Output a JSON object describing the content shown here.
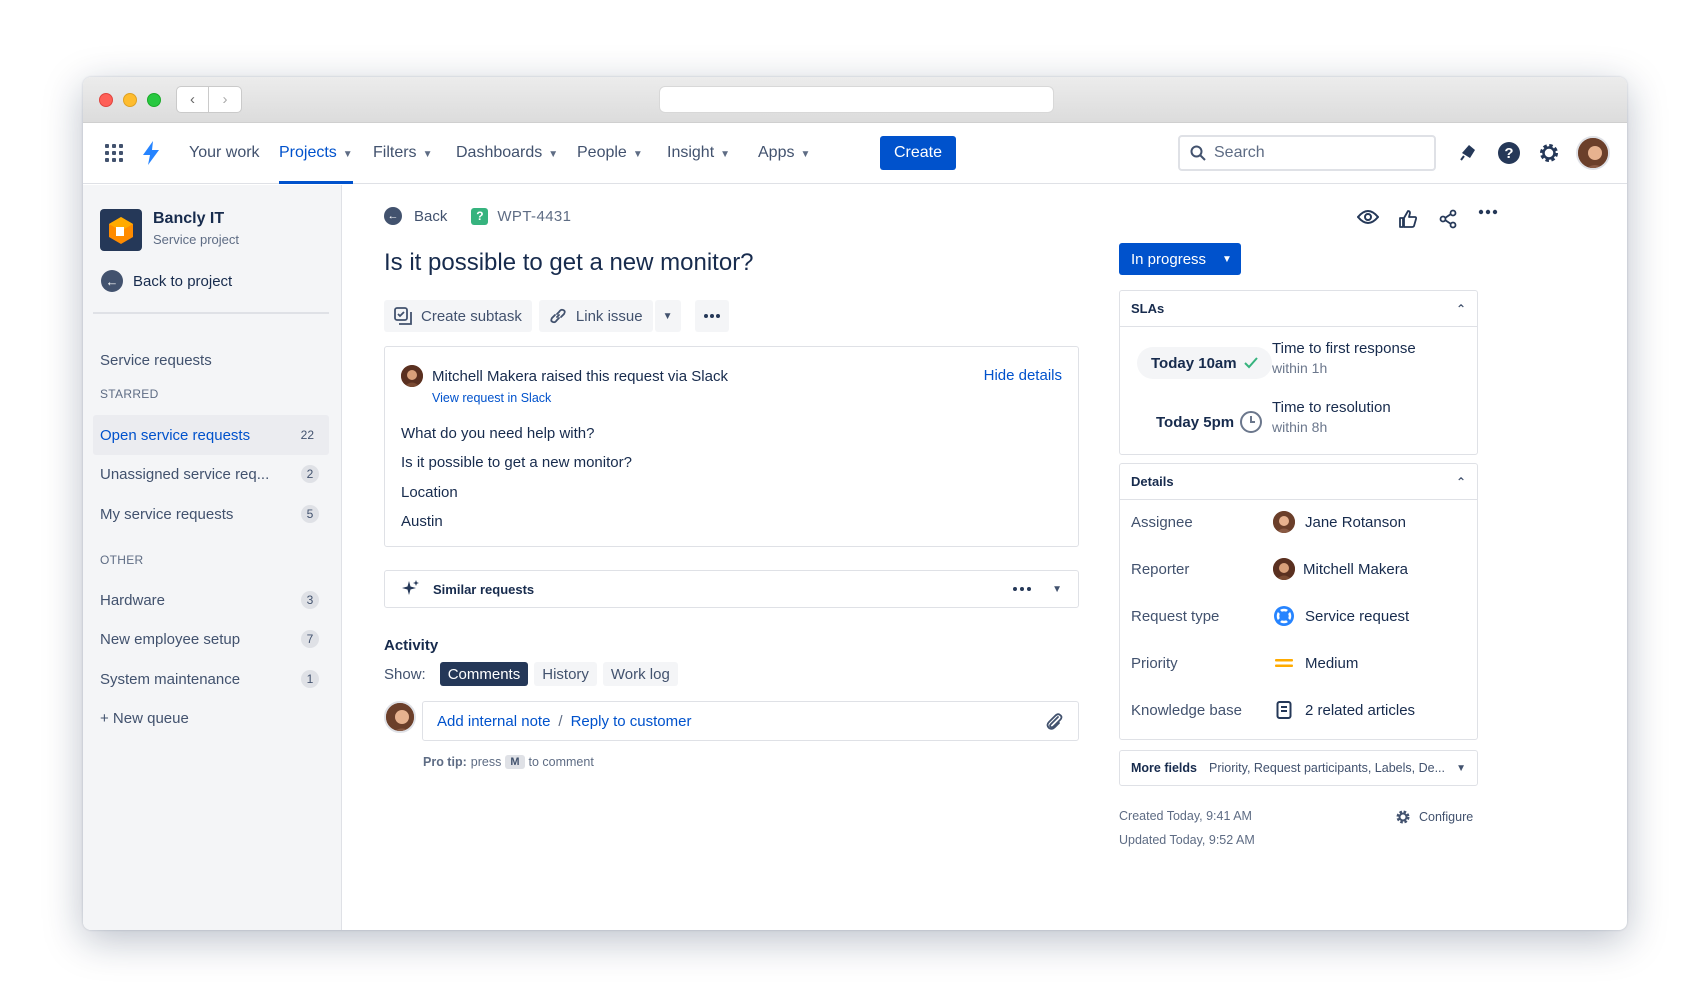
{
  "nav": {
    "your_work": "Your work",
    "projects": "Projects",
    "filters": "Filters",
    "dashboards": "Dashboards",
    "people": "People",
    "insight": "Insight",
    "apps": "Apps",
    "create": "Create",
    "search_placeholder": "Search"
  },
  "sidebar": {
    "project_name": "Bancly IT",
    "project_type": "Service project",
    "back": "Back to project",
    "service_requests": "Service requests",
    "starred_heading": "STARRED",
    "other_heading": "OTHER",
    "starred": [
      {
        "label": "Open service requests",
        "count": "22"
      },
      {
        "label": "Unassigned service req...",
        "count": "2"
      },
      {
        "label": "My service requests",
        "count": "5"
      }
    ],
    "other": [
      {
        "label": "Hardware",
        "count": "3"
      },
      {
        "label": "New employee setup",
        "count": "7"
      },
      {
        "label": "System maintenance",
        "count": "1"
      }
    ],
    "new_queue": "+ New queue"
  },
  "issue": {
    "back": "Back",
    "key": "WPT-4431",
    "title": "Is it possible to get a new monitor?",
    "actions": {
      "create_subtask": "Create subtask",
      "link_issue": "Link issue"
    },
    "request": {
      "raised_by": "Mitchell Makera raised this request via Slack",
      "view_link": "View request in Slack",
      "hide_details": "Hide details",
      "q1": "What do you need help with?",
      "a1": "Is it possible to get a new monitor?",
      "q2": "Location",
      "a2": "Austin"
    },
    "similar": "Similar requests",
    "activity": {
      "heading": "Activity",
      "show": "Show:",
      "tabs": [
        "Comments",
        "History",
        "Work log"
      ],
      "add_note": "Add internal note",
      "slash": "/",
      "reply": "Reply to customer",
      "protip_bold": "Pro tip:",
      "protip_press": "press",
      "protip_key": "M",
      "protip_rest": "to comment"
    }
  },
  "right": {
    "status": "In progress",
    "slas": {
      "heading": "SLAs",
      "items": [
        {
          "time": "Today 10am",
          "label": "Time to first response",
          "sub": "within 1h"
        },
        {
          "time": "Today 5pm",
          "label": "Time to resolution",
          "sub": "within 8h"
        }
      ]
    },
    "details": {
      "heading": "Details",
      "rows": [
        {
          "label": "Assignee",
          "value": "Jane Rotanson"
        },
        {
          "label": "Reporter",
          "value": "Mitchell Makera"
        },
        {
          "label": "Request type",
          "value": "Service request"
        },
        {
          "label": "Priority",
          "value": "Medium"
        },
        {
          "label": "Knowledge base",
          "value": "2 related articles"
        }
      ]
    },
    "more_fields": {
      "label": "More fields",
      "value": "Priority, Request participants, Labels, De..."
    },
    "created": "Created Today, 9:41 AM",
    "updated": "Updated Today, 9:52 AM",
    "configure": "Configure"
  },
  "colors": {
    "primary": "#0052cc",
    "success": "#36b37e",
    "priority_medium": "#ffab00"
  }
}
